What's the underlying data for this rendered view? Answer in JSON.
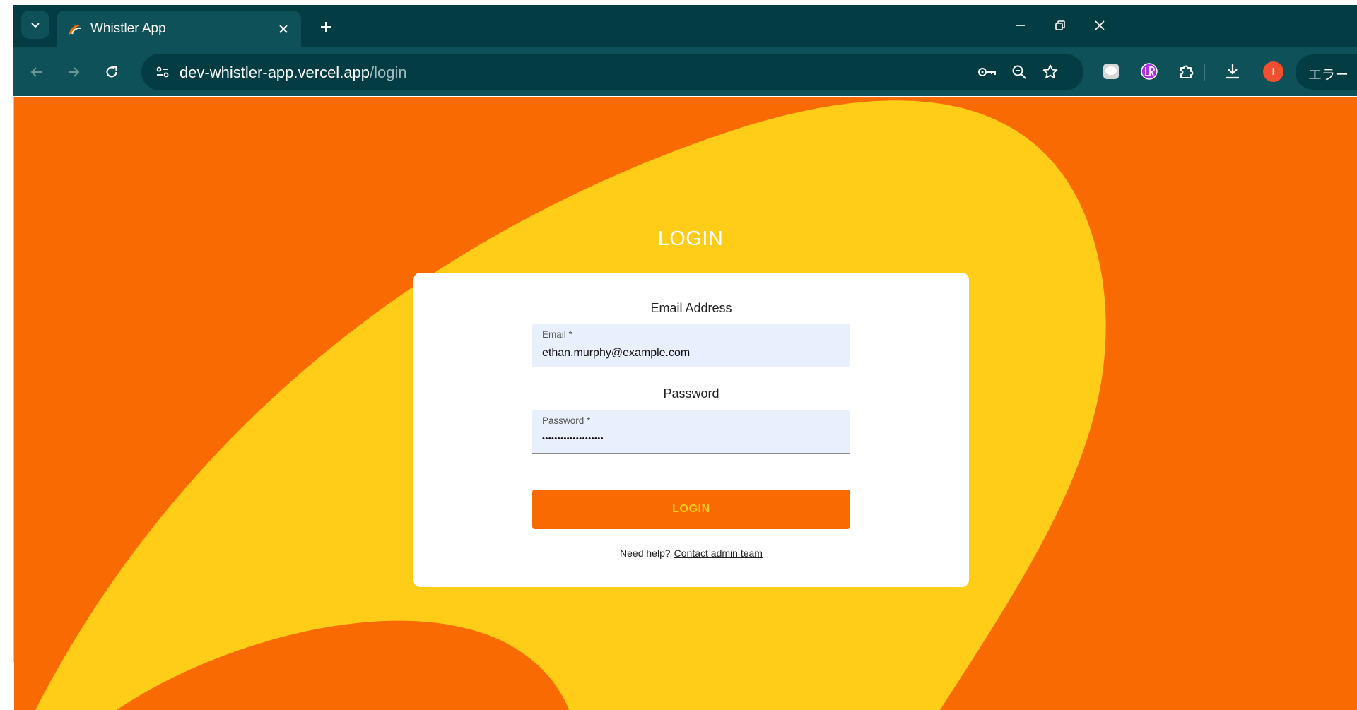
{
  "browser": {
    "tab_title": "Whistler App",
    "url_host": "dev-whistler-app.vercel.app",
    "url_path": "/login",
    "profile_initial": "I",
    "error_label": "エラー",
    "colors": {
      "frame": "#033c43",
      "toolbar": "#0e5158",
      "avatar": "#f0502d"
    }
  },
  "page": {
    "heading": "LOGIN",
    "colors": {
      "background": "#f96a02",
      "blob": "#ffcc17",
      "accent_text": "#ffcc17"
    },
    "form": {
      "email_section_label": "Email Address",
      "email_field_label": "Email *",
      "email_value": "ethan.murphy@example.com",
      "password_section_label": "Password",
      "password_field_label": "Password *",
      "password_value": "••••••••••••••••••••",
      "submit_label": "LOGIN"
    },
    "help": {
      "prefix": "Need help?",
      "link_text": "Contact admin team"
    }
  }
}
